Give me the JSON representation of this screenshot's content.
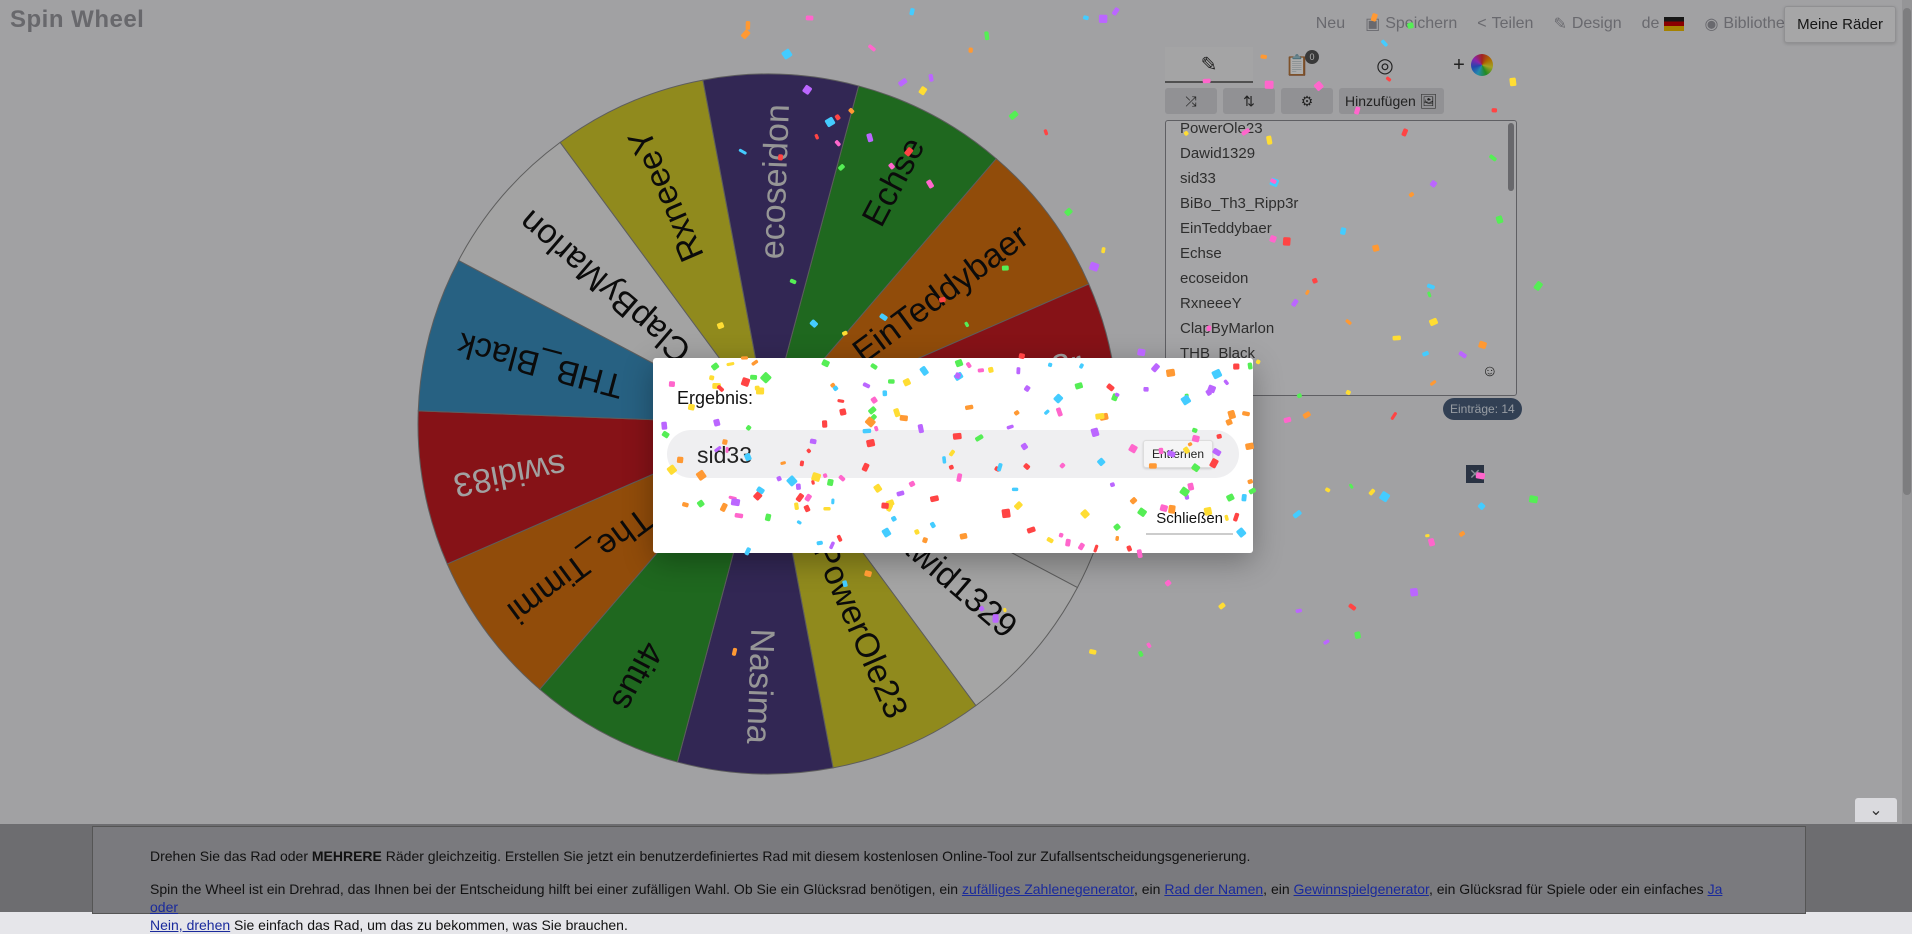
{
  "header": {
    "brand": "Spin Wheel",
    "nav": [
      {
        "label": "Neu",
        "icon": ""
      },
      {
        "label": "Speichern",
        "icon": "save-icon"
      },
      {
        "label": "Teilen",
        "icon": "share-icon"
      },
      {
        "label": "Design",
        "icon": "pen-icon"
      },
      {
        "label": "de",
        "icon": "flag-de-icon"
      },
      {
        "label": "Bibliothek",
        "icon": "globe-icon"
      }
    ],
    "my_wheels": "Meine Räder"
  },
  "wheel": {
    "segments": [
      {
        "label": "Echse",
        "color": "#2e9a2e",
        "text_color": "#111"
      },
      {
        "label": "EinTeddybaer",
        "color": "#d6700f",
        "text_color": "#111"
      },
      {
        "label": "BiBo_Th3_Ripp3r",
        "color": "#c61b22",
        "text_color": "#eee"
      },
      {
        "label": "sid33",
        "color": "#e6e6e6",
        "text_color": "#111"
      },
      {
        "label": "Dawid1329",
        "color": "#f4f4f4",
        "text_color": "#111"
      },
      {
        "label": "PowerOle23",
        "color": "#d5cc2c",
        "text_color": "#111"
      },
      {
        "label": "Nasima",
        "color": "#4a3a7c",
        "text_color": "#ddd"
      },
      {
        "label": "4itus",
        "color": "#2e9a2e",
        "text_color": "#111"
      },
      {
        "label": "The_Timmi",
        "color": "#d6700f",
        "text_color": "#111"
      },
      {
        "label": "swidi83",
        "color": "#c61b22",
        "text_color": "#eee"
      },
      {
        "label": "THB_Black",
        "color": "#3a8fc0",
        "text_color": "#111"
      },
      {
        "label": "ClapByMarlon",
        "color": "#f0f0f0",
        "text_color": "#111"
      },
      {
        "label": "RxneeeY",
        "color": "#d5cc2c",
        "text_color": "#111"
      },
      {
        "label": "ecoseidon",
        "color": "#4a3a7c",
        "text_color": "#ddd"
      }
    ]
  },
  "panel": {
    "tabs": [
      {
        "icon": "pencil-icon"
      },
      {
        "icon": "clipboard-list-icon",
        "badge": "0"
      },
      {
        "icon": "eye-off-icon"
      },
      {
        "icon": "plus-color-icon",
        "label": "+"
      }
    ],
    "tools": {
      "shuffle": "⤮",
      "sort": "⇅",
      "settings": "⚙",
      "add_label": "Hinzufügen",
      "image": "🖼"
    },
    "entries": [
      "PowerOle23",
      "Dawid1329",
      "sid33",
      "BiBo_Th3_Ripp3r",
      "EinTeddybaer",
      "Echse",
      "ecoseidon",
      "RxneeeY",
      "ClapByMarlon",
      "THB_Black"
    ],
    "emoji": "☺",
    "count": "Einträge: 14",
    "close_small": "✕"
  },
  "dialog": {
    "title": "Ergebnis:",
    "result": "sid33",
    "remove": "Entfernen",
    "close": "Schließen"
  },
  "footer": {
    "collapse": "⌄",
    "line1_pre": "Drehen Sie das Rad oder ",
    "line1_bold": "MEHRERE",
    "line1_post": " Räder gleichzeitig. Erstellen Sie jetzt ein benutzerdefiniertes Rad mit diesem kostenlosen Online-Tool zur Zufallsentscheidungsgenerierung.",
    "line2_a": "Spin the Wheel ist ein Drehrad, das Ihnen bei der Entscheidung hilft bei einer zufälligen Wahl. Ob Sie ein Glücksrad benötigen, ein ",
    "link1": "zufälliges Zahlenegenerator",
    "line2_b": ", ein ",
    "link2": "Rad der Namen",
    "line2_c": ", ein ",
    "link3": "Gewinnspielgenerator",
    "line2_d": ", ein Glücksrad für Spiele oder ein einfaches ",
    "link4": "Ja oder",
    "link5": "Nein, drehen",
    "line3": " Sie einfach das Rad, um das zu bekommen, was Sie brauchen."
  },
  "colors": {
    "overlay": "rgba(0,0,0,0.32)",
    "confetti": [
      "#f44",
      "#4cf",
      "#fd3",
      "#b6f",
      "#5e5",
      "#f93",
      "#f6c"
    ]
  }
}
